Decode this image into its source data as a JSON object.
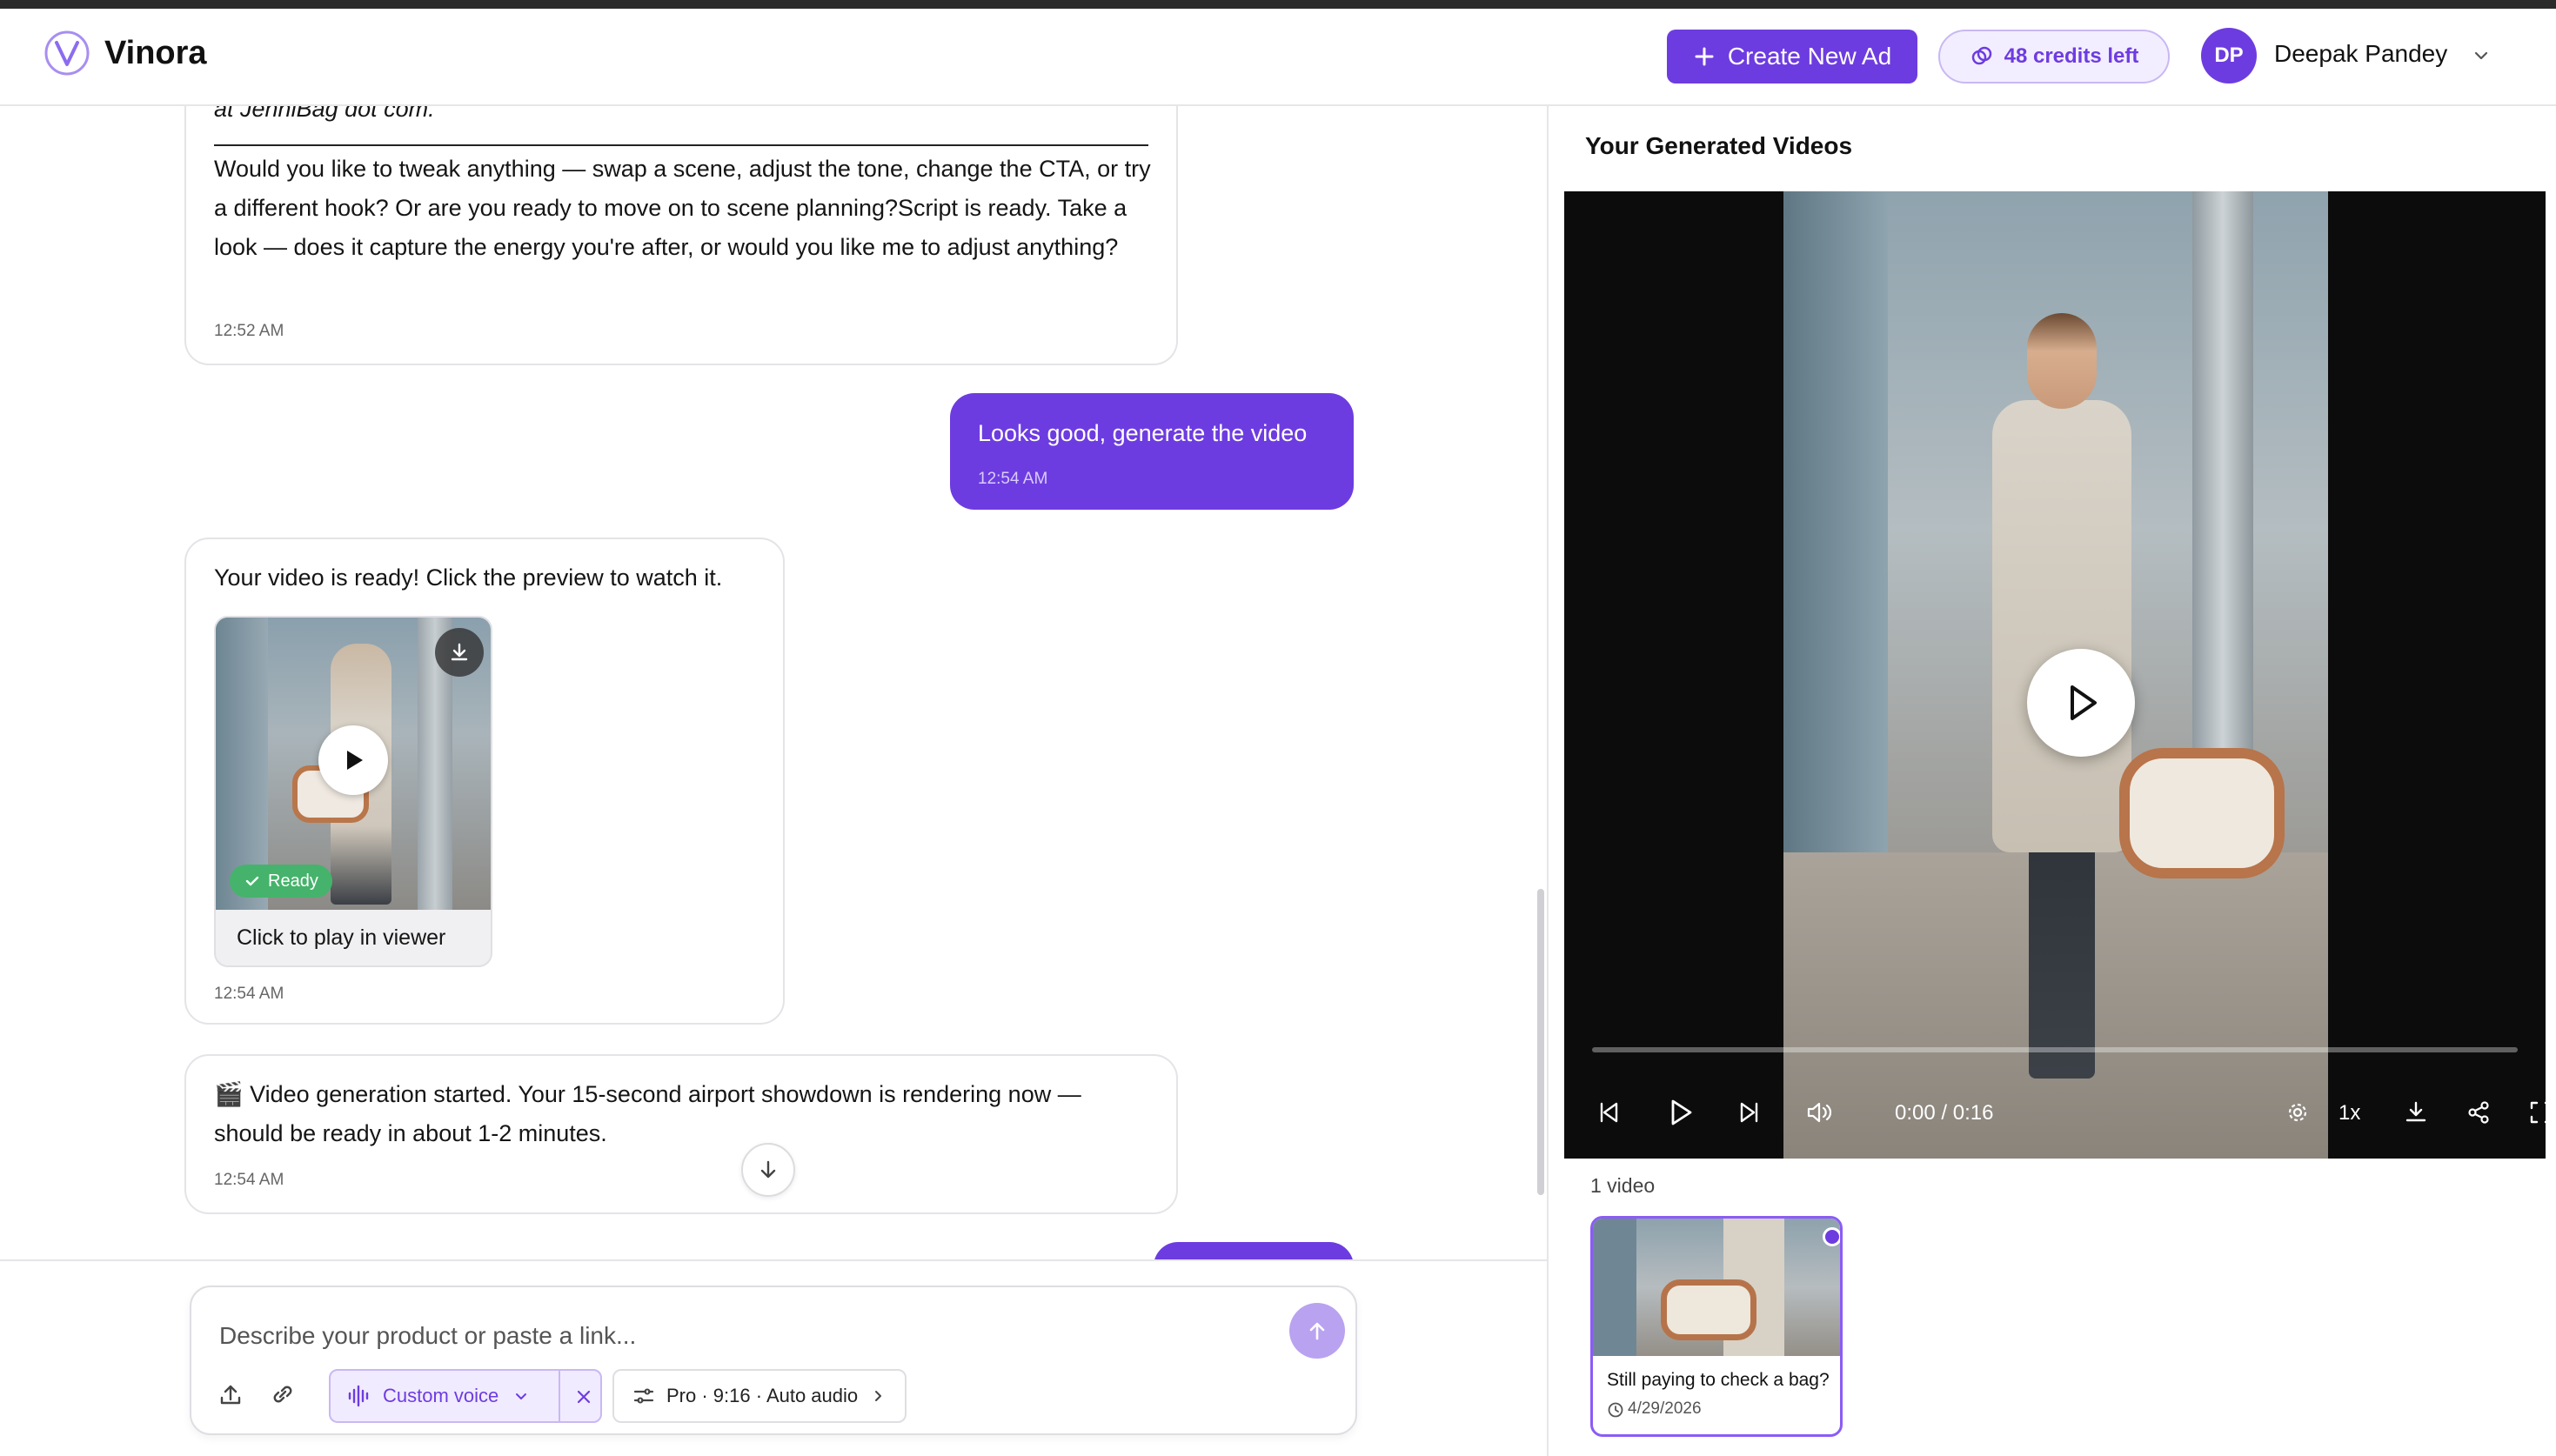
{
  "app": {
    "brand": "Vinora"
  },
  "header": {
    "create_label": "Create New Ad",
    "credits_label": "48 credits left",
    "user_initials": "DP",
    "user_name": "Deepak Pandey"
  },
  "chat": {
    "messages": [
      {
        "role": "assistant",
        "quote_tail": "at JenniBag dot com.”",
        "text": "Would you like to tweak anything — swap a scene, adjust the tone, change the CTA, or try a different hook? Or are you ready to move on to scene planning?Script is ready. Take a look — does it capture the energy you're after, or would you like me to adjust anything?",
        "time": "12:52 AM"
      },
      {
        "role": "user",
        "text": "Looks good, generate the video",
        "time": "12:54 AM"
      },
      {
        "role": "assistant",
        "text": "Your video is ready! Click the preview to watch it.",
        "badge": "Ready",
        "thumb_caption": "Click to play in viewer",
        "time": "12:54 AM"
      },
      {
        "role": "assistant",
        "text": "🎬 Video generation started. Your 15-second airport showdown is rendering now — should be ready in about 1-2 minutes.",
        "time": "12:54 AM"
      }
    ]
  },
  "composer": {
    "placeholder": "Describe your product or paste a link...",
    "voice_label": "Custom voice",
    "options_label": "Pro · 9:16 · Auto audio"
  },
  "right_panel": {
    "title": "Your Generated Videos",
    "player": {
      "timecode": "0:00 / 0:16",
      "speed": "1x",
      "progress": 0
    },
    "count_label": "1 video",
    "videos": [
      {
        "title": "Still paying to check a bag?",
        "date": "4/29/2026",
        "selected": true
      }
    ]
  },
  "colors": {
    "accent": "#6d3ce0",
    "ready_green": "#45b36b"
  }
}
